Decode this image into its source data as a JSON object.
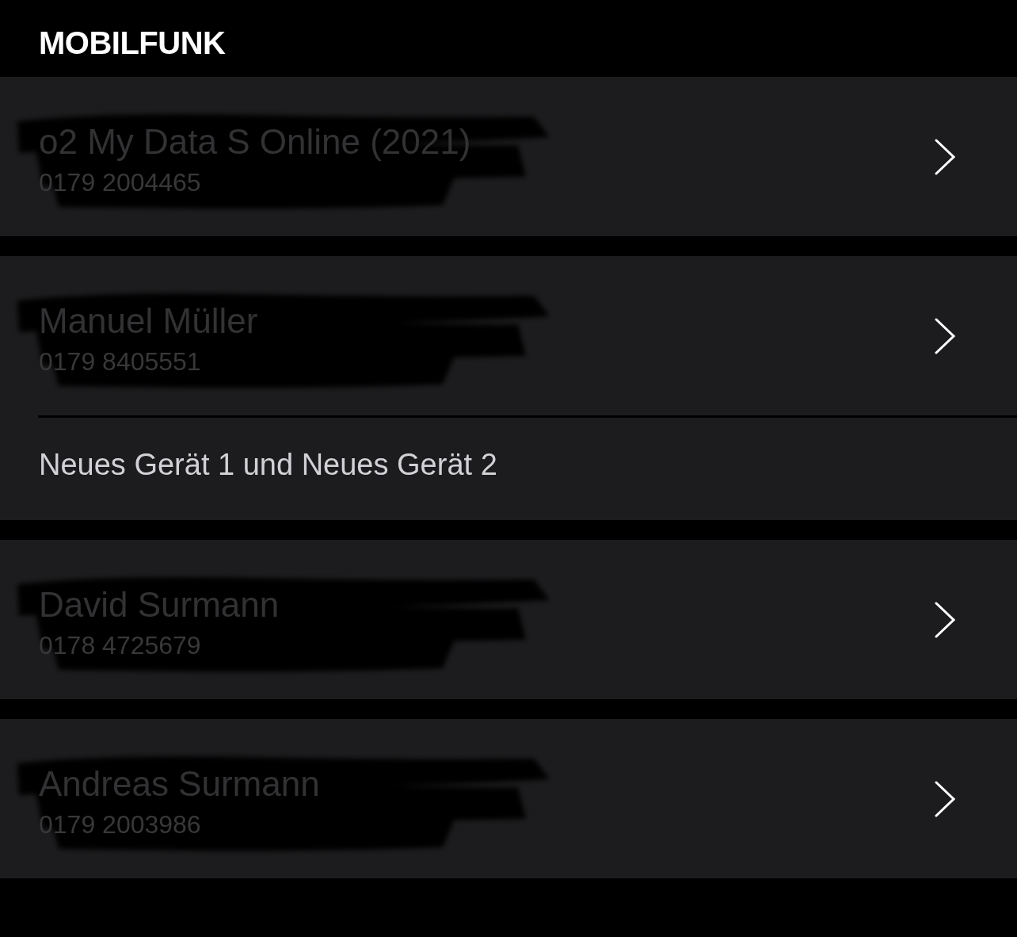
{
  "header": {
    "title": "MOBILFUNK"
  },
  "contracts": [
    {
      "name": "o2 My Data S Online (2021)",
      "number": "0179 2004465",
      "redacted": true
    },
    {
      "name": "Manuel Müller",
      "number": "0179 8405551",
      "redacted": true,
      "note": "Neues Gerät 1 und Neues Gerät 2"
    },
    {
      "name": "David Surmann",
      "number": "0178 4725679",
      "redacted": true
    },
    {
      "name": "Andreas Surmann",
      "number": "0179 2003986",
      "redacted": true
    }
  ]
}
